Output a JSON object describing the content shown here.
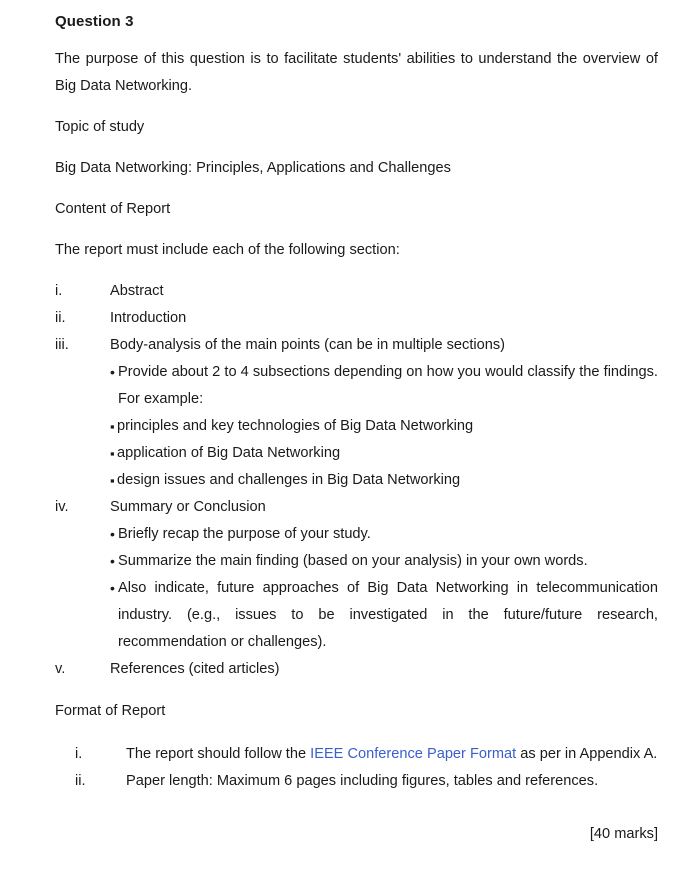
{
  "document": {
    "heading": "Question 3",
    "intro": "The purpose of this question is to facilitate students' abilities to understand the overview of Big Data Networking.",
    "topic_label": "Topic of study",
    "topic_value": "Big Data Networking: Principles, Applications and Challenges",
    "content_label": "Content of Report",
    "content_intro": "The report must include each of the following section:",
    "sections": [
      {
        "marker": "i.",
        "text": "Abstract"
      },
      {
        "marker": "ii.",
        "text": "Introduction"
      },
      {
        "marker": "iii.",
        "text": "Body-analysis of the main points (can be in multiple sections)"
      },
      {
        "marker": "iv.",
        "text": "Summary or Conclusion"
      },
      {
        "marker": "v.",
        "text": "References (cited articles)"
      }
    ],
    "body_bullets": [
      {
        "mark": "•",
        "text": "Provide about 2 to 4 subsections depending on how you would classify the findings. For example:"
      },
      {
        "mark": "▪",
        "text": "principles and key technologies of Big Data Networking"
      },
      {
        "mark": "▪",
        "text": "application of Big Data Networking"
      },
      {
        "mark": "▪",
        "text": "design issues and challenges in Big Data Networking"
      }
    ],
    "summary_bullets": [
      {
        "mark": "•",
        "text": "Briefly recap the purpose of your study."
      },
      {
        "mark": "•",
        "text": "Summarize the main finding (based on your analysis) in your own words."
      },
      {
        "mark": "•",
        "text": "Also indicate, future approaches of Big Data Networking in telecommunication industry. (e.g., issues to be investigated in the future/future research, recommendation or challenges)."
      }
    ],
    "format_label": "Format of Report",
    "format_items": [
      {
        "marker": "i.",
        "text_before": "The report should follow the ",
        "link_text": "IEEE Conference Paper Format",
        "text_after": " as per in Appendix A."
      },
      {
        "marker": "ii.",
        "text_before": "Paper length: Maximum 6 pages including figures, tables and references.",
        "link_text": "",
        "text_after": ""
      }
    ],
    "marks": "[40 marks]",
    "link_color": "#3a5fcd"
  }
}
